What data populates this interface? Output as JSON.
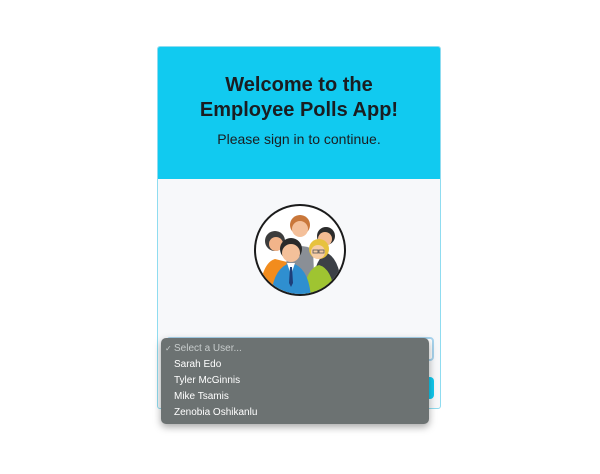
{
  "login": {
    "title_line1": "Welcome to the",
    "title_line2": "Employee Polls App!",
    "subtitle": "Please sign in to continue.",
    "avatar_icon": "employees-group-icon"
  },
  "user_select": {
    "selected_placeholder": "Select a User...",
    "checkmark": "✓",
    "options": [
      "Sarah Edo",
      "Tyler McGinnis",
      "Mike Tsamis",
      "Zenobia Oshikanlu"
    ]
  },
  "colors": {
    "accent": "#11caf0",
    "dropdown_bg": "#6c7272"
  }
}
